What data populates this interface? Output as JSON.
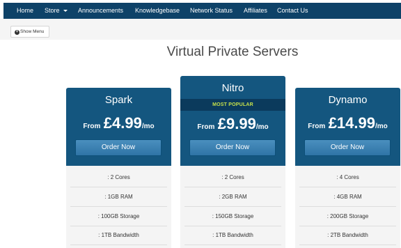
{
  "nav": {
    "items": [
      "Home",
      "Store",
      "Announcements",
      "Knowledgebase",
      "Network Status",
      "Affiliates",
      "Contact Us"
    ]
  },
  "show_menu_label": "Show Menu",
  "page_title": "Virtual Private Servers",
  "plans": [
    {
      "name": "Spark",
      "badge": "",
      "price_prefix": "From",
      "price": "£4.99",
      "price_suffix": "/mo",
      "button": "Order Now",
      "features": [
        ": 2 Cores",
        ": 1GB RAM",
        ": 100GB Storage",
        ": 1TB Bandwidth"
      ]
    },
    {
      "name": "Nitro",
      "badge": "MOST POPULAR",
      "price_prefix": "From",
      "price": "£9.99",
      "price_suffix": "/mo",
      "button": "Order Now",
      "features": [
        ": 2 Cores",
        ": 2GB RAM",
        ": 150GB Storage",
        ": 1TB Bandwidth"
      ]
    },
    {
      "name": "Dynamo",
      "badge": "",
      "price_prefix": "From",
      "price": "£14.99",
      "price_suffix": "/mo",
      "button": "Order Now",
      "features": [
        ": 4 Cores",
        ": 4GB RAM",
        ": 200GB Storage",
        ": 2TB Bandwidth"
      ]
    }
  ],
  "colors": {
    "nav_bg": "#0e4268",
    "card_header": "#14567f",
    "badge_bg": "#0b3a5c",
    "badge_text": "#c6e04a",
    "card_body": "#f4f4f4"
  }
}
